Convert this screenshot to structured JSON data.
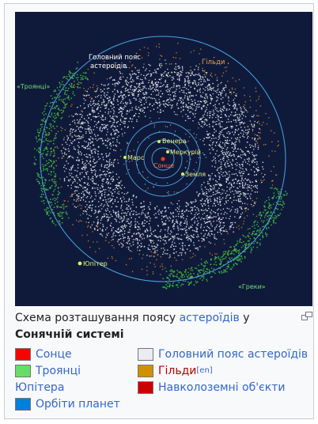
{
  "figure": {
    "labels": {
      "main_belt": [
        "Головний пояс",
        "астероїдів"
      ],
      "hildas": "Гільди",
      "trojans": "«Троянці»",
      "greeks": "«Греки»",
      "jupiter": "Юпітер",
      "mars": "Марс",
      "venus": "Венера",
      "mercury": "Меркурій",
      "sun": "Сонце",
      "earth": "Земля"
    },
    "colors": {
      "background": "#0f1a3b",
      "orbit": "#4aa3e0",
      "belt": "#e8e8e8",
      "trojans": "#3fbf3f",
      "hildas": "#e08a1e",
      "sun": "#ff3a1a",
      "planet": "#d8f05a"
    }
  },
  "caption": {
    "part1": "Схема розташування поясу ",
    "link": "астероїдів",
    "part2": " у ",
    "bold": "Сонячній системі"
  },
  "legend": {
    "sun": {
      "label": "Сонце",
      "color": "#ff0000"
    },
    "trojans": {
      "label": "Троянці",
      "color": "#66dd66"
    },
    "jupiter": {
      "label": "Юпітера"
    },
    "orbits": {
      "label": "Орбіти планет",
      "color": "#0080dd"
    },
    "main_belt": {
      "label": "Головний пояс астероїдів",
      "color": "#eaecf0"
    },
    "hildas": {
      "label": "Гільди",
      "sup": "[en]",
      "color": "#d09000"
    },
    "neo": {
      "label": "Навколоземні об'єкти",
      "color": "#cc0000"
    }
  }
}
